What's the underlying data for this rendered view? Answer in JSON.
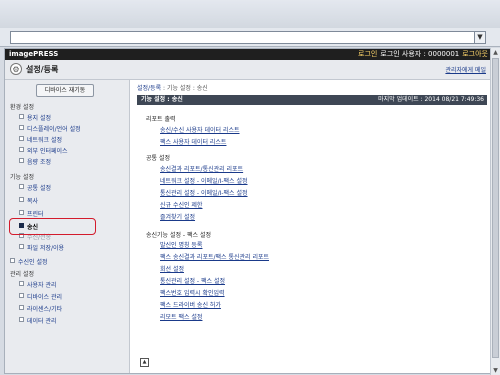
{
  "header": {
    "brand": "imagePRESS",
    "logout_prefix": "로그인",
    "user_label": "로그인 사용자 : 0000001",
    "logout_label": "로그아웃",
    "title": "설정/등록",
    "admin_link": "관리자에게 메일"
  },
  "sidebar": {
    "restart_button": "디바이스 재기동",
    "sections": [
      {
        "label": "환경 설정",
        "items": [
          "용지 설정",
          "디스플레이/언어 설정",
          "네트워크 설정",
          "외부 인터페이스",
          "음량 조정"
        ]
      },
      {
        "label": "기능 설정",
        "items": [
          "공통 설정",
          "복사",
          "프린터",
          "송신",
          "수신/전송",
          "파일 저장/이용"
        ]
      },
      {
        "label": "수신인 설정",
        "items": []
      },
      {
        "label": "관리 설정",
        "items": [
          "사용자 관리",
          "디바이스 관리",
          "라이센스/기타",
          "데이터 관리"
        ]
      }
    ],
    "selected_item": "송신"
  },
  "main": {
    "breadcrumb": {
      "link": "설정/등록",
      "sep": " : ",
      "path": "기능 설정 : 송신"
    },
    "header_title": "기능 설정 : 송신",
    "last_updated": "마지막 업데이트 : 2014 08/21 7:49:36",
    "groups": [
      {
        "title": "리포트 출력",
        "links": [
          "송신/수신 사용자 데이터 리스트",
          "팩스 사용자 데이터 리스트"
        ]
      },
      {
        "title": "공통 설정",
        "links": [
          "송신결과 리포트/통신관리 리포트",
          "네트워크 설정 - 이메일/I-팩스 설정",
          "통신관리 설정 - 이메일/I-팩스 설정",
          "신규 수신인 제한",
          "즐겨찾기 설정"
        ]
      },
      {
        "title": "송신기능 설정 - 팩스 설정",
        "links": [
          "발신인 명칭 등록",
          "팩스 송신결과 리포트/팩스 통신관리 리포트",
          "회선 설정",
          "통신관리 설정 - 팩스 설정",
          "팩스번호 입력시 확인입력",
          "팩스 드라이버 송신 허가",
          "리모트 팩스 설정"
        ]
      }
    ]
  }
}
